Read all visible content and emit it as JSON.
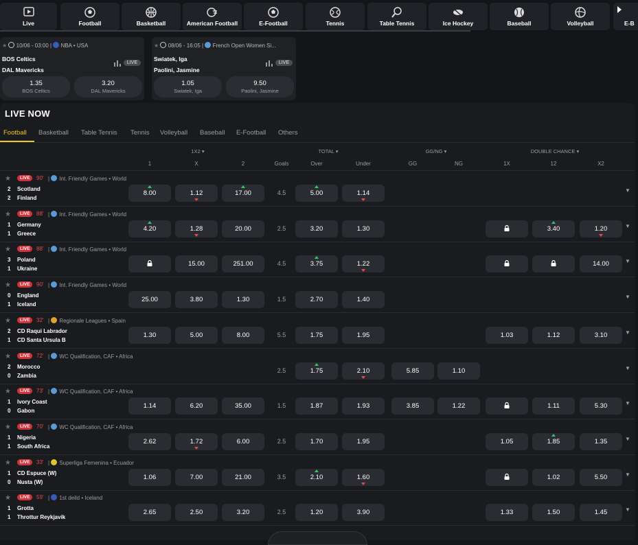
{
  "sports": [
    {
      "label": "Live",
      "icon": "live-icon"
    },
    {
      "label": "Football",
      "icon": "football-icon"
    },
    {
      "label": "Basketball",
      "icon": "basketball-icon"
    },
    {
      "label": "American Football",
      "icon": "american-football-icon"
    },
    {
      "label": "E-Football",
      "icon": "e-football-icon"
    },
    {
      "label": "Tennis",
      "icon": "tennis-icon"
    },
    {
      "label": "Table Tennis",
      "icon": "table-tennis-icon"
    },
    {
      "label": "Ice Hockey",
      "icon": "ice-hockey-icon"
    },
    {
      "label": "Baseball",
      "icon": "baseball-icon"
    },
    {
      "label": "Volleyball",
      "icon": "volleyball-icon"
    },
    {
      "label": "E-B",
      "icon": "e-basketball-icon"
    }
  ],
  "featured": [
    {
      "time": "10/06 - 03:00",
      "league": "NBA",
      "region": "USA",
      "team1": "BOS Celtics",
      "team2": "DAL Mavericks",
      "live": "LIVE",
      "odds": [
        {
          "value": "1.35",
          "name": "BOS Celtics"
        },
        {
          "value": "3.20",
          "name": "DAL Mavericks"
        }
      ]
    },
    {
      "time": "08/06 - 16:05",
      "league": "French Open Women Si...",
      "region": "",
      "team1": "Swiatek, Iga",
      "team2": "Paolini, Jasmine",
      "live": "LIVE",
      "odds": [
        {
          "value": "1.05",
          "name": "Swiatek, Iga"
        },
        {
          "value": "9.50",
          "name": "Paolini, Jasmine"
        }
      ]
    }
  ],
  "live_now": {
    "title": "LIVE NOW",
    "tabs": [
      "Football",
      "Basketball",
      "Table Tennis",
      "Tennis",
      "Volleyball",
      "Baseball",
      "E-Football",
      "Others"
    ],
    "active_tab": "Football",
    "group_headers": [
      "1X2",
      "TOTAL",
      "GG/NG",
      "DOUBLE CHANCE"
    ],
    "columns": [
      "1",
      "X",
      "2",
      "Goals",
      "Over",
      "Under",
      "GG",
      "NG",
      "1X",
      "12",
      "X2"
    ]
  },
  "matches": [
    {
      "live": "LIVE",
      "minute": "90'",
      "league": "Int. Friendly Games",
      "region": "World",
      "flag": "#5a9ad6",
      "s1": "2",
      "s2": "2",
      "t1": "Scotland",
      "t2": "Finland",
      "o1": "8.00",
      "ox": "1.12",
      "o2": "17.00",
      "goals": "4.5",
      "over": "5.00",
      "under": "1.14",
      "gg": "",
      "ng": "",
      "d1x": "",
      "d12": "",
      "dx2": "",
      "ar": {
        "o1": "up",
        "ox": "dn",
        "o2": "up",
        "over": "up",
        "under": "dn"
      }
    },
    {
      "live": "LIVE",
      "minute": "88'",
      "league": "Int. Friendly Games",
      "region": "World",
      "flag": "#5a9ad6",
      "s1": "1",
      "s2": "1",
      "t1": "Germany",
      "t2": "Greece",
      "o1": "4.20",
      "ox": "1.28",
      "o2": "20.00",
      "goals": "2.5",
      "over": "3.20",
      "under": "1.30",
      "gg": "",
      "ng": "",
      "d1x": "LOCK",
      "d12": "3.40",
      "dx2": "1.20",
      "ar": {
        "o1": "up",
        "ox": "dn",
        "d12": "up",
        "dx2": "dn"
      }
    },
    {
      "live": "LIVE",
      "minute": "88'",
      "league": "Int. Friendly Games",
      "region": "World",
      "flag": "#5a9ad6",
      "s1": "3",
      "s2": "1",
      "t1": "Poland",
      "t2": "Ukraine",
      "o1": "LOCK",
      "ox": "15.00",
      "o2": "251.00",
      "goals": "4.5",
      "over": "3.75",
      "under": "1.22",
      "gg": "",
      "ng": "",
      "d1x": "LOCK",
      "d12": "LOCK",
      "dx2": "14.00",
      "ar": {
        "over": "up",
        "under": "dn"
      }
    },
    {
      "live": "LIVE",
      "minute": "90'",
      "league": "Int. Friendly Games",
      "region": "World",
      "flag": "#5a9ad6",
      "s1": "0",
      "s2": "1",
      "t1": "England",
      "t2": "Iceland",
      "o1": "25.00",
      "ox": "3.80",
      "o2": "1.30",
      "goals": "1.5",
      "over": "2.70",
      "under": "1.40",
      "gg": "",
      "ng": "",
      "d1x": "",
      "d12": "",
      "dx2": "",
      "ar": {}
    },
    {
      "live": "LIVE",
      "minute": "32'",
      "league": "Regionale Leagues",
      "region": "Spain",
      "flag": "#e0a32a",
      "s1": "2",
      "s2": "1",
      "t1": "CD Raqui Labrador",
      "t2": "CD Santa Ursula B",
      "o1": "1.30",
      "ox": "5.00",
      "o2": "8.00",
      "goals": "5.5",
      "over": "1.75",
      "under": "1.95",
      "gg": "",
      "ng": "",
      "d1x": "1.03",
      "d12": "1.12",
      "dx2": "3.10",
      "ar": {}
    },
    {
      "live": "LIVE",
      "minute": "72'",
      "league": "WC Qualification, CAF",
      "region": "Africa",
      "flag": "#5a9ad6",
      "s1": "2",
      "s2": "0",
      "t1": "Morocco",
      "t2": "Zambia",
      "o1": "",
      "ox": "",
      "o2": "",
      "goals": "2.5",
      "over": "1.75",
      "under": "2.10",
      "gg": "5.85",
      "ng": "1.10",
      "d1x": "",
      "d12": "",
      "dx2": "",
      "ar": {
        "over": "up",
        "under": "dn"
      }
    },
    {
      "live": "LIVE",
      "minute": "73'",
      "league": "WC Qualification, CAF",
      "region": "Africa",
      "flag": "#5a9ad6",
      "s1": "1",
      "s2": "0",
      "t1": "Ivory Coast",
      "t2": "Gabon",
      "o1": "1.14",
      "ox": "6.20",
      "o2": "35.00",
      "goals": "1.5",
      "over": "1.87",
      "under": "1.93",
      "gg": "3.85",
      "ng": "1.22",
      "d1x": "LOCK",
      "d12": "1.11",
      "dx2": "5.30",
      "ar": {}
    },
    {
      "live": "LIVE",
      "minute": "70'",
      "league": "WC Qualification, CAF",
      "region": "Africa",
      "flag": "#5a9ad6",
      "s1": "1",
      "s2": "1",
      "t1": "Nigeria",
      "t2": "South Africa",
      "o1": "2.62",
      "ox": "1.72",
      "o2": "6.00",
      "goals": "2.5",
      "over": "1.70",
      "under": "1.95",
      "gg": "",
      "ng": "",
      "d1x": "1.05",
      "d12": "1.85",
      "dx2": "1.35",
      "ar": {
        "ox": "dn",
        "d12": "up"
      }
    },
    {
      "live": "LIVE",
      "minute": "33'",
      "league": "Superliga Femenina",
      "region": "Ecuador",
      "flag": "#e0c32a",
      "s1": "1",
      "s2": "0",
      "t1": "CD Espuce (W)",
      "t2": "Nusta (W)",
      "o1": "1.06",
      "ox": "7.00",
      "o2": "21.00",
      "goals": "3.5",
      "over": "2.10",
      "under": "1.60",
      "gg": "",
      "ng": "",
      "d1x": "LOCK",
      "d12": "1.02",
      "dx2": "5.50",
      "ar": {
        "over": "up",
        "under": "dn"
      }
    },
    {
      "live": "LIVE",
      "minute": "59'",
      "league": "1st deild",
      "region": "Iceland",
      "flag": "#3b5bb5",
      "s1": "1",
      "s2": "1",
      "t1": "Grotta",
      "t2": "Throttur Reykjavik",
      "o1": "2.65",
      "ox": "2.50",
      "o2": "3.20",
      "goals": "2.5",
      "over": "1.20",
      "under": "3.90",
      "gg": "",
      "ng": "",
      "d1x": "1.33",
      "d12": "1.50",
      "dx2": "1.45",
      "ar": {}
    }
  ]
}
